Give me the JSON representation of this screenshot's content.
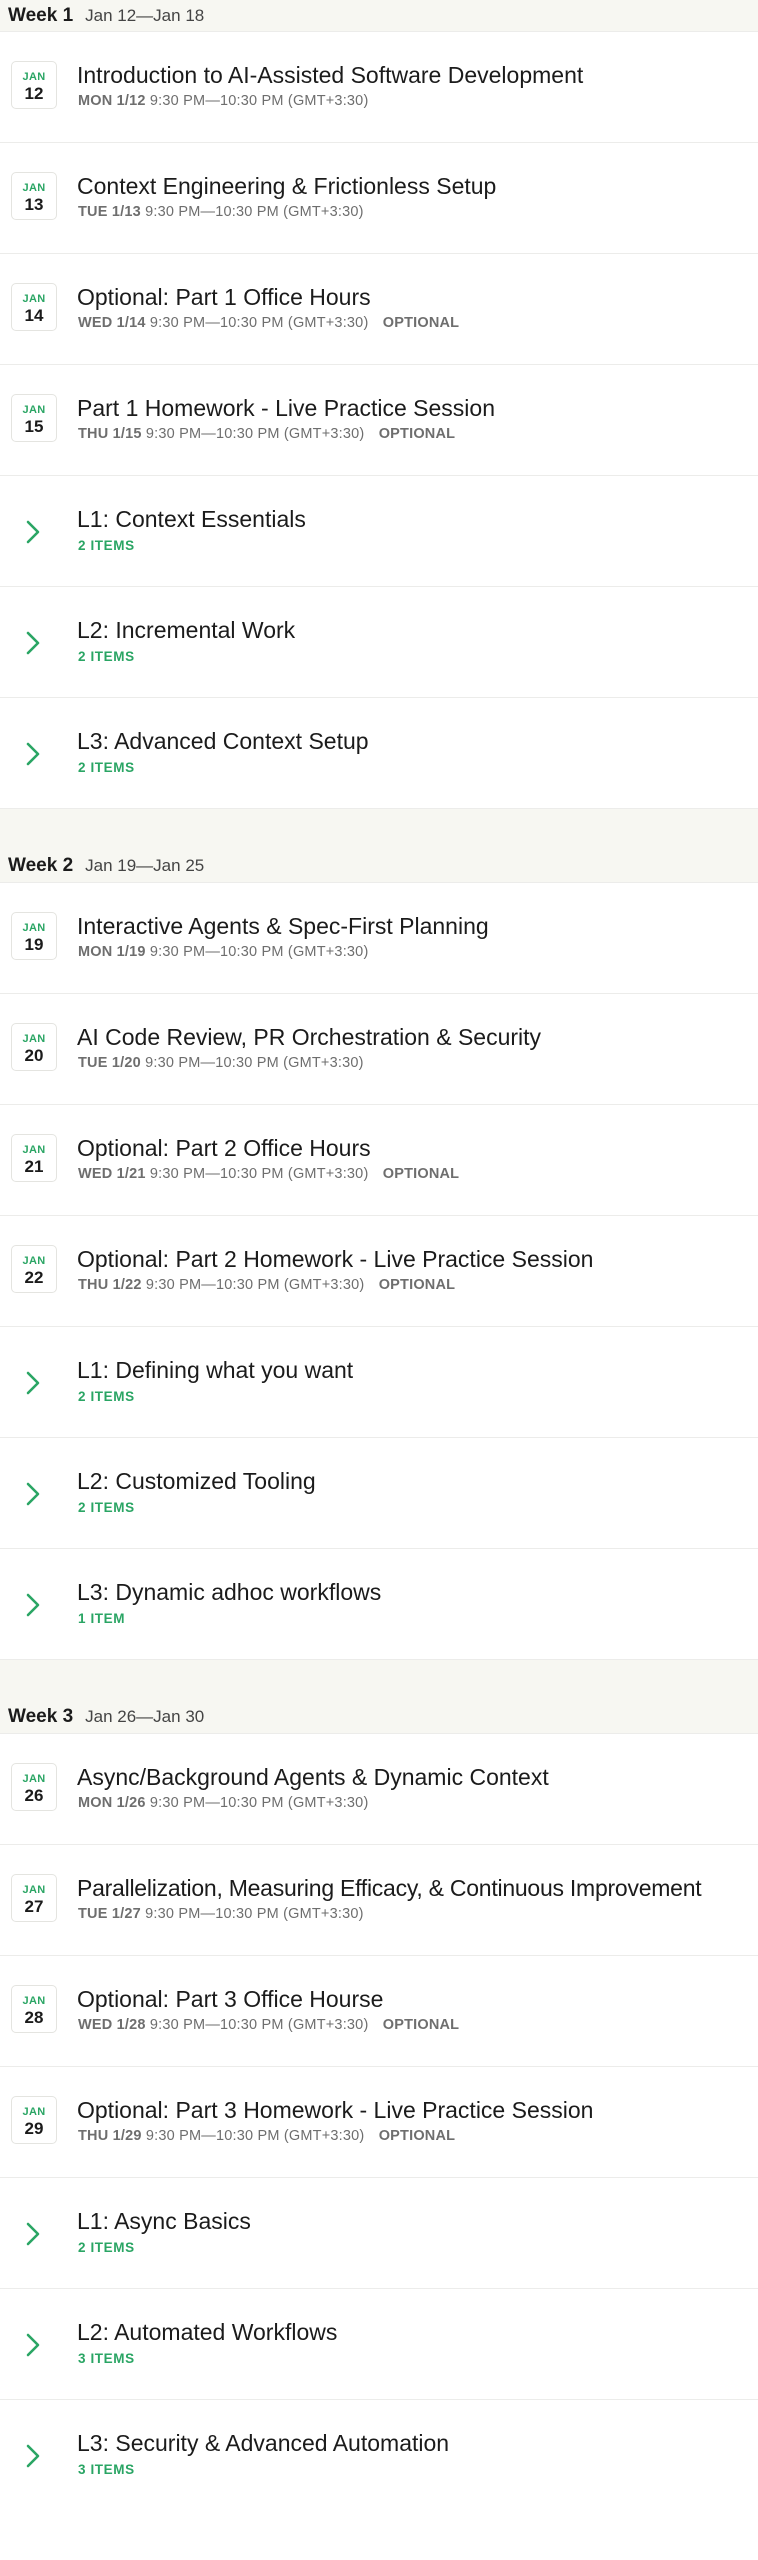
{
  "colors": {
    "accent_green": "#2aa564",
    "header_bg": "#f7f7f2",
    "muted_text": "#6e6e6e"
  },
  "weeks": [
    {
      "title": "Week 1",
      "range": "Jan 12—Jan 18",
      "sessions": [
        {
          "month": "JAN",
          "day": "12",
          "title": "Introduction to AI-Assisted Software Development",
          "weekday": "MON 1/12",
          "time": "9:30 PM—10:30 PM (GMT+3:30)",
          "optional": ""
        },
        {
          "month": "JAN",
          "day": "13",
          "title": "Context Engineering & Frictionless Setup",
          "weekday": "TUE 1/13",
          "time": "9:30 PM—10:30 PM (GMT+3:30)",
          "optional": ""
        },
        {
          "month": "JAN",
          "day": "14",
          "title": "Optional: Part 1 Office Hours",
          "weekday": "WED 1/14",
          "time": "9:30 PM—10:30 PM (GMT+3:30)",
          "optional": "OPTIONAL"
        },
        {
          "month": "JAN",
          "day": "15",
          "title": "Part 1 Homework - Live Practice Session",
          "weekday": "THU 1/15",
          "time": "9:30 PM—10:30 PM (GMT+3:30)",
          "optional": "OPTIONAL"
        }
      ],
      "lessons": [
        {
          "icon": "chevron-right-icon",
          "title": "L1: Context Essentials",
          "count": "2 ITEMS"
        },
        {
          "icon": "chevron-right-icon",
          "title": "L2: Incremental Work",
          "count": "2 ITEMS"
        },
        {
          "icon": "chevron-right-icon",
          "title": "L3: Advanced Context Setup",
          "count": "2 ITEMS"
        }
      ]
    },
    {
      "title": "Week 2",
      "range": "Jan 19—Jan 25",
      "sessions": [
        {
          "month": "JAN",
          "day": "19",
          "title": "Interactive Agents & Spec-First Planning",
          "weekday": "MON 1/19",
          "time": "9:30 PM—10:30 PM (GMT+3:30)",
          "optional": ""
        },
        {
          "month": "JAN",
          "day": "20",
          "title": "AI Code Review, PR Orchestration & Security",
          "weekday": "TUE 1/20",
          "time": "9:30 PM—10:30 PM (GMT+3:30)",
          "optional": ""
        },
        {
          "month": "JAN",
          "day": "21",
          "title": "Optional: Part 2 Office Hours",
          "weekday": "WED 1/21",
          "time": "9:30 PM—10:30 PM (GMT+3:30)",
          "optional": "OPTIONAL"
        },
        {
          "month": "JAN",
          "day": "22",
          "title": "Optional: Part 2 Homework - Live Practice Session",
          "weekday": "THU 1/22",
          "time": "9:30 PM—10:30 PM (GMT+3:30)",
          "optional": "OPTIONAL"
        }
      ],
      "lessons": [
        {
          "icon": "chevron-right-icon",
          "title": "L1: Defining what you want",
          "count": "2 ITEMS"
        },
        {
          "icon": "chevron-right-icon",
          "title": "L2: Customized Tooling",
          "count": "2 ITEMS"
        },
        {
          "icon": "chevron-right-icon",
          "title": "L3: Dynamic adhoc workflows",
          "count": "1 ITEM"
        }
      ]
    },
    {
      "title": "Week 3",
      "range": "Jan 26—Jan 30",
      "sessions": [
        {
          "month": "JAN",
          "day": "26",
          "title": "Async/Background Agents & Dynamic Context",
          "weekday": "MON 1/26",
          "time": "9:30 PM—10:30 PM (GMT+3:30)",
          "optional": ""
        },
        {
          "month": "JAN",
          "day": "27",
          "title": "Parallelization, Measuring Efficacy, & Continuous Improvement",
          "weekday": "TUE 1/27",
          "time": "9:30 PM—10:30 PM (GMT+3:30)",
          "optional": ""
        },
        {
          "month": "JAN",
          "day": "28",
          "title": "Optional: Part 3 Office Hourse",
          "weekday": "WED 1/28",
          "time": "9:30 PM—10:30 PM (GMT+3:30)",
          "optional": "OPTIONAL"
        },
        {
          "month": "JAN",
          "day": "29",
          "title": "Optional: Part 3 Homework - Live Practice Session",
          "weekday": "THU 1/29",
          "time": "9:30 PM—10:30 PM (GMT+3:30)",
          "optional": "OPTIONAL"
        }
      ],
      "lessons": [
        {
          "icon": "chevron-right-icon",
          "title": "L1: Async Basics",
          "count": "2 ITEMS"
        },
        {
          "icon": "chevron-right-icon",
          "title": "L2: Automated Workflows",
          "count": "3 ITEMS"
        },
        {
          "icon": "chevron-right-icon",
          "title": "L3: Security & Advanced Automation",
          "count": "3 ITEMS"
        }
      ]
    }
  ]
}
